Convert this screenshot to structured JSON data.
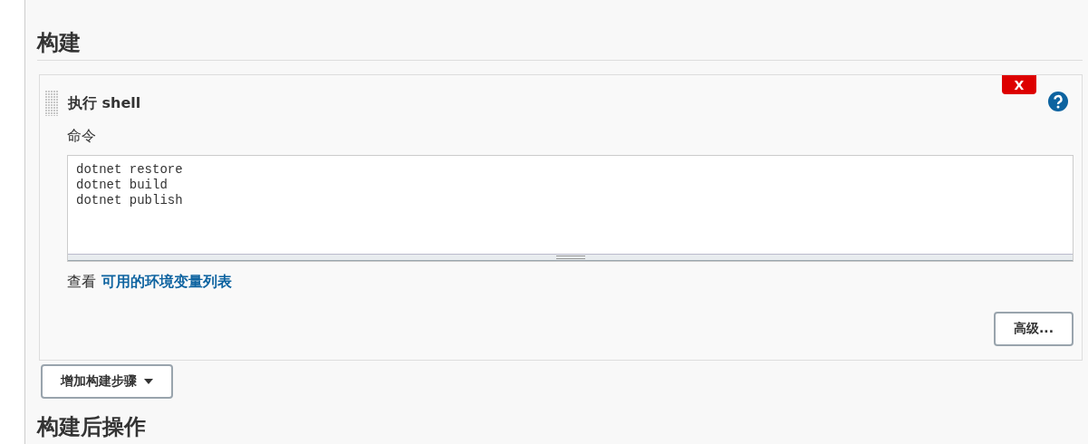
{
  "section": {
    "title": "构建"
  },
  "build_step": {
    "title": "执行 shell",
    "delete_label": "X",
    "field_label": "命令",
    "command": "dotnet restore\ndotnet build\ndotnet publish",
    "hint_prefix": "查看",
    "hint_link": "可用的环境变量列表",
    "advanced_button": "高级..."
  },
  "add_step_button": "增加构建步骤",
  "next_section": {
    "title": "构建后操作"
  }
}
